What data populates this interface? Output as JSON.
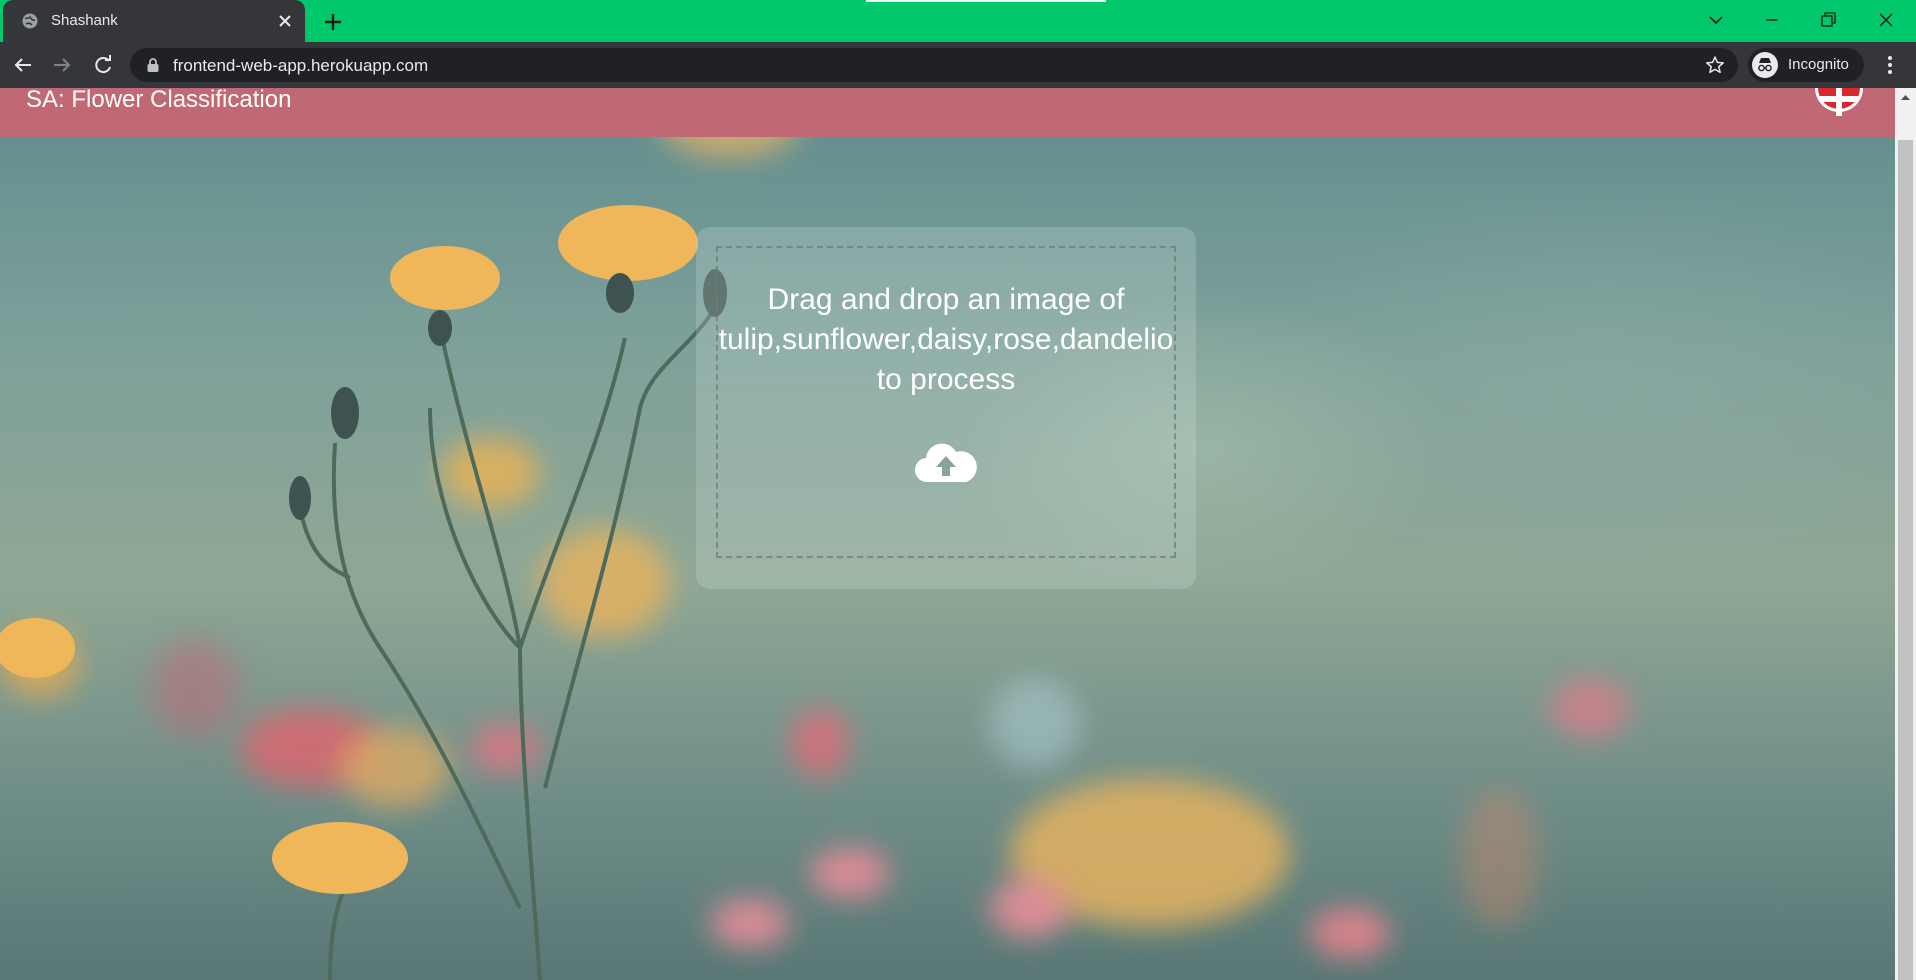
{
  "browser": {
    "tab_title": "Shashank",
    "url": "frontend-web-app.herokuapp.com",
    "profile_label": "Incognito",
    "icons": {
      "favicon": "globe-icon",
      "close": "close-icon",
      "new_tab": "plus-icon",
      "back": "back-arrow-icon",
      "forward": "forward-arrow-icon",
      "reload": "reload-icon",
      "lock": "lock-icon",
      "bookmark": "star-icon",
      "incognito": "incognito-icon",
      "menu": "kebab-menu-icon",
      "tab_search": "chevron-down-icon",
      "minimize": "minimize-icon",
      "restore": "restore-icon",
      "window_close": "window-close-icon"
    },
    "colors": {
      "frame": "#00c86b",
      "toolbar": "#35363a",
      "omnibox": "#202124"
    }
  },
  "page": {
    "header": {
      "title": "SA: Flower Classification",
      "badge_icon": "red-cross-badge-icon",
      "color": "#c06974"
    },
    "upload": {
      "prompt_line1": "Drag and drop an image of",
      "prompt_line2": "tulip,sunflower,daisy,rose,dandelio",
      "prompt_line3": "to process",
      "icon": "cloud-upload-icon"
    }
  }
}
